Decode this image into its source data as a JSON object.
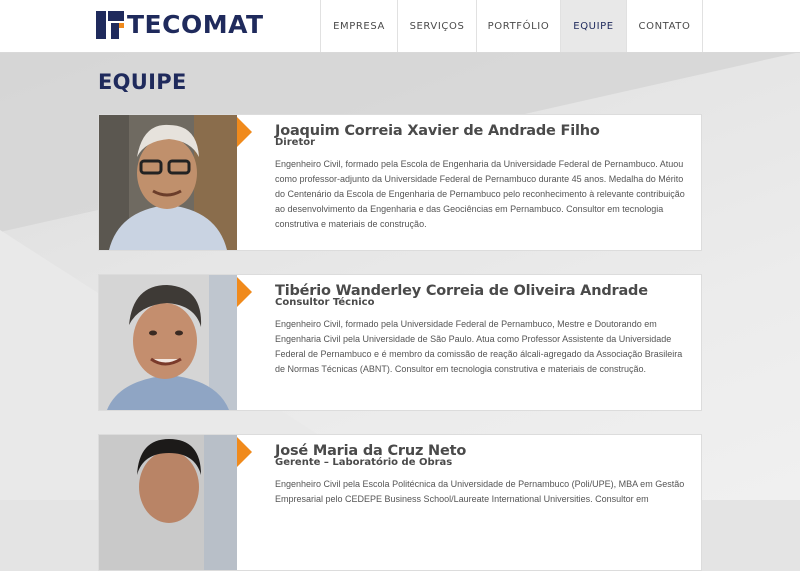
{
  "site": {
    "logo_text": "TECOMAT"
  },
  "nav": {
    "items": [
      {
        "label": "EMPRESA"
      },
      {
        "label": "SERVIÇOS"
      },
      {
        "label": "PORTFÓLIO"
      },
      {
        "label": "EQUIPE",
        "active": true
      },
      {
        "label": "CONTATO"
      }
    ]
  },
  "page": {
    "title": "EQUIPE"
  },
  "team": [
    {
      "name": "Joaquim Correia Xavier de Andrade Filho",
      "role": "Diretor",
      "bio": "Engenheiro Civil, formado pela Escola de Engenharia da Universidade Federal de Pernambuco. Atuou como professor-adjunto da Universidade Federal de Pernambuco durante 45 anos. Medalha do Mérito do Centenário da Escola de Engenharia de Pernambuco pelo reconhecimento à relevante contribuição ao desenvolvimento da Engenharia e das Geociências em Pernambuco. Consultor em tecnologia construtiva e materiais de construção."
    },
    {
      "name": "Tibério Wanderley Correia de Oliveira Andrade",
      "role": "Consultor Técnico",
      "bio": "Engenheiro Civil, formado pela Universidade Federal de Pernambuco, Mestre e Doutorando em Engenharia Civil pela Universidade de São Paulo. Atua como Professor Assistente da Universidade Federal de Pernambuco e é membro da comissão de reação álcali-agregado da Associação Brasileira de Normas Técnicas (ABNT). Consultor em tecnologia construtiva e materiais de construção."
    },
    {
      "name": "José Maria da Cruz Neto",
      "role": "Gerente – Laboratório de Obras",
      "bio": "Engenheiro Civil pela Escola Politécnica da Universidade de Pernambuco (Poli/UPE), MBA em Gestão Empresarial pelo CEDEPE Business School/Laureate International Universities. Consultor em"
    }
  ],
  "colors": {
    "navy": "#1f2a5c",
    "accent_orange": "#f08a1c"
  }
}
